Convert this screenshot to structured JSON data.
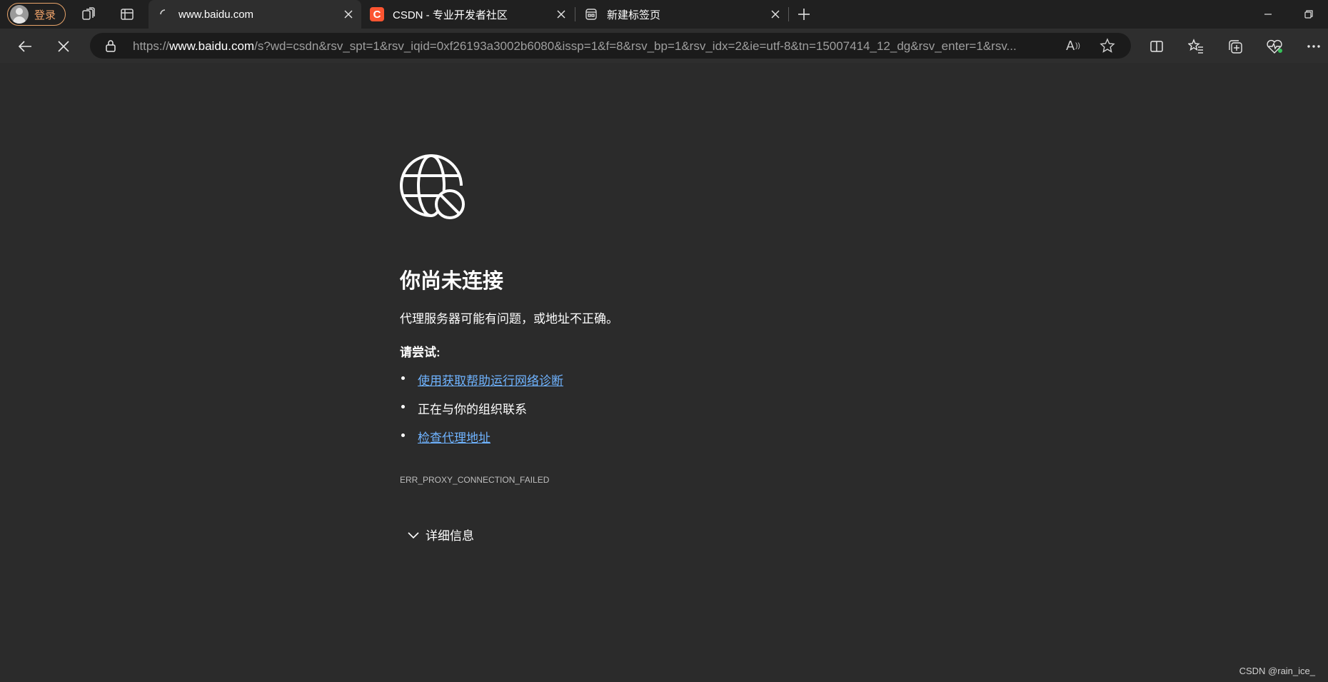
{
  "colors": {
    "tabstrip_bg": "#202020",
    "toolbar_bg": "#2e2e2e",
    "page_bg": "#2b2b2b",
    "addressbar_bg": "#1b1b1b",
    "profile_accent": "#f0a36a",
    "link": "#6fb3ff",
    "csdn_brand": "#fc5531"
  },
  "profile": {
    "label": "登录",
    "icon": "avatar-icon"
  },
  "tabs": [
    {
      "title": "www.baidu.com",
      "icon": "loading-spinner-icon",
      "active": true
    },
    {
      "title": "CSDN - 专业开发者社区",
      "icon": "csdn-favicon",
      "favicon_letter": "C",
      "active": false
    },
    {
      "title": "新建标签页",
      "icon": "new-tab-page-icon",
      "active": false
    }
  ],
  "toolbar": {
    "url": {
      "scheme": "https://",
      "host": "www.baidu.com",
      "rest": "/s?wd=csdn&rsv_spt=1&rsv_iqid=0xf26193a3002b6080&issp=1&f=8&rsv_bp=1&rsv_idx=2&ie=utf-8&tn=15007414_12_dg&rsv_enter=1&rsv..."
    },
    "read_aloud_glyph": "A"
  },
  "error": {
    "title": "你尚未连接",
    "description": "代理服务器可能有问题，或地址不正确。",
    "try_label": "请尝试:",
    "suggestions": [
      {
        "text": "使用获取帮助运行网络诊断",
        "link": true
      },
      {
        "text": "正在与你的组织联系",
        "link": false
      },
      {
        "text": "检查代理地址",
        "link": true
      }
    ],
    "code": "ERR_PROXY_CONNECTION_FAILED",
    "details_label": "详细信息"
  },
  "watermark": "CSDN @rain_ice_"
}
